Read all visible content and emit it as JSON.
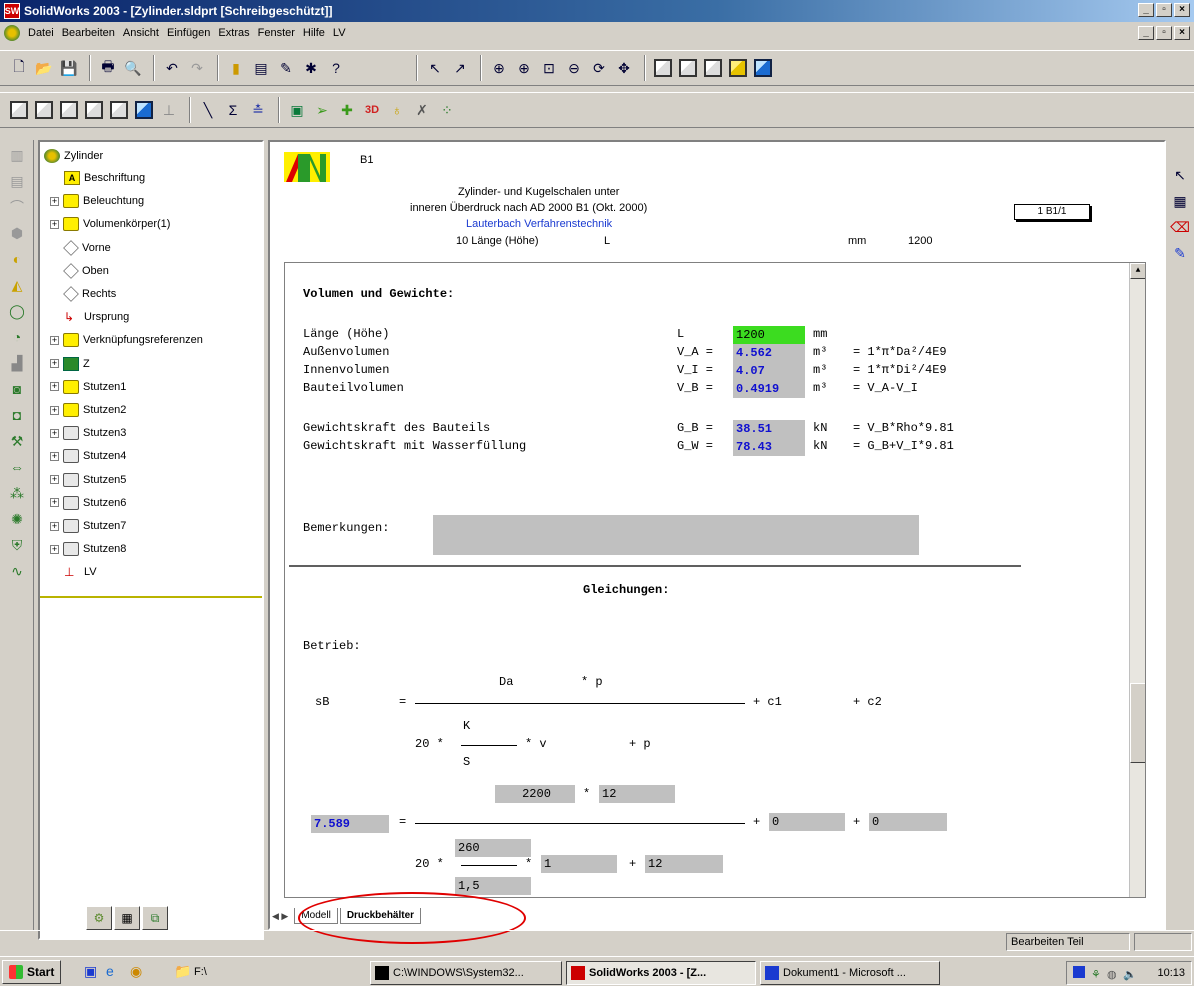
{
  "window": {
    "title": "SolidWorks 2003 - [Zylinder.sldprt [Schreibgeschützt]]",
    "icon_text": "SW",
    "buttons": [
      "_",
      "▫",
      "×"
    ]
  },
  "menu": [
    "Datei",
    "Bearbeiten",
    "Ansicht",
    "Einfügen",
    "Extras",
    "Fenster",
    "Hilfe",
    "LV"
  ],
  "feature_tree": {
    "root": "Zylinder",
    "items": [
      {
        "label": "Beschriftung",
        "icon": "annotation-icon",
        "expandable": false
      },
      {
        "label": "Beleuchtung",
        "icon": "lighting-icon",
        "expandable": true
      },
      {
        "label": "Volumenkörper(1)",
        "icon": "solid-body-icon",
        "expandable": true
      },
      {
        "label": "Vorne",
        "icon": "plane-icon",
        "expandable": false
      },
      {
        "label": "Oben",
        "icon": "plane-icon",
        "expandable": false
      },
      {
        "label": "Rechts",
        "icon": "plane-icon",
        "expandable": false
      },
      {
        "label": "Ursprung",
        "icon": "origin-icon",
        "expandable": false
      },
      {
        "label": "Verknüpfungsreferenzen",
        "icon": "mate-ref-icon",
        "expandable": true
      },
      {
        "label": "Z",
        "icon": "feature-icon",
        "expandable": true
      },
      {
        "label": "Stutzen1",
        "icon": "folder-yellow-icon",
        "expandable": true
      },
      {
        "label": "Stutzen2",
        "icon": "folder-yellow-icon",
        "expandable": true
      },
      {
        "label": "Stutzen3",
        "icon": "folder-gray-icon",
        "expandable": true
      },
      {
        "label": "Stutzen4",
        "icon": "folder-gray-icon",
        "expandable": true
      },
      {
        "label": "Stutzen5",
        "icon": "folder-gray-icon",
        "expandable": true
      },
      {
        "label": "Stutzen6",
        "icon": "folder-gray-icon",
        "expandable": true
      },
      {
        "label": "Stutzen7",
        "icon": "folder-gray-icon",
        "expandable": true
      },
      {
        "label": "Stutzen8",
        "icon": "folder-gray-icon",
        "expandable": true
      },
      {
        "label": "LV",
        "icon": "lv-icon",
        "expandable": false
      }
    ]
  },
  "header": {
    "code": "B1",
    "line1": "Zylinder- und Kugelschalen unter",
    "line2": "inneren Überdruck nach AD 2000 B1 (Okt. 2000)",
    "line3": "Lauterbach Verfahrenstechnik",
    "param_label": "10 Länge (Höhe)",
    "param_sym": "L",
    "param_unit": "mm",
    "param_value": "1200",
    "sheet": "1 B1/1"
  },
  "doc": {
    "section_title": "Volumen und Gewichte:",
    "rows": [
      {
        "label": "Länge (Höhe)",
        "sym": "L",
        "value": "1200",
        "unit": "mm",
        "formula": ""
      },
      {
        "label": "Außenvolumen",
        "sym": "V_A =",
        "value": "4.562",
        "unit": "m³",
        "formula": "= 1*π*Da²/4E9"
      },
      {
        "label": "Innenvolumen",
        "sym": "V_I =",
        "value": "4.07",
        "unit": "m³",
        "formula": "= 1*π*Di²/4E9"
      },
      {
        "label": "Bauteilvolumen",
        "sym": "V_B =",
        "value": "0.4919",
        "unit": "m³",
        "formula": "= V_A-V_I"
      },
      {
        "label": "Gewichtskraft des Bauteils",
        "sym": "G_B =",
        "value": "38.51",
        "unit": "kN",
        "formula": "= V_B*Rho*9.81"
      },
      {
        "label": "Gewichtskraft mit Wasserfüllung",
        "sym": "G_W =",
        "value": "78.43",
        "unit": "kN",
        "formula": "= G_B+V_I*9.81"
      }
    ],
    "remarks_label": "Bemerkungen:",
    "equations_title": "Gleichungen:",
    "operation_label": "Betrieb:",
    "sym_eq": {
      "lhs": "sB",
      "eq": "=",
      "num_da": "Da",
      "num_p": "* p",
      "plus_c1": "+ c1",
      "plus_c2": "+ c2",
      "den_20": "20 *",
      "den_k": "K",
      "den_s": "S",
      "den_v": "* v",
      "den_p": "+ p"
    },
    "num_eq": {
      "result": "7.589",
      "eq": "=",
      "da": "2200",
      "mult": "*",
      "p": "12",
      "plus1": "+",
      "c1": "0",
      "plus2": "+",
      "c2": "0",
      "den_20": "20 *",
      "k": "260",
      "s": "1,5",
      "v_mult": "*",
      "v": "1",
      "p_plus": "+",
      "p2": "12"
    }
  },
  "sheet_tabs": [
    "Modell",
    "Druckbehälter"
  ],
  "status": {
    "text": "Bearbeiten Teil"
  },
  "taskbar": {
    "start": "Start",
    "folder": "F:\\",
    "tasks": [
      "C:\\WINDOWS\\System32...",
      "SolidWorks 2003 - [Z...",
      "Dokument1 - Microsoft ..."
    ],
    "clock": "10:13"
  }
}
